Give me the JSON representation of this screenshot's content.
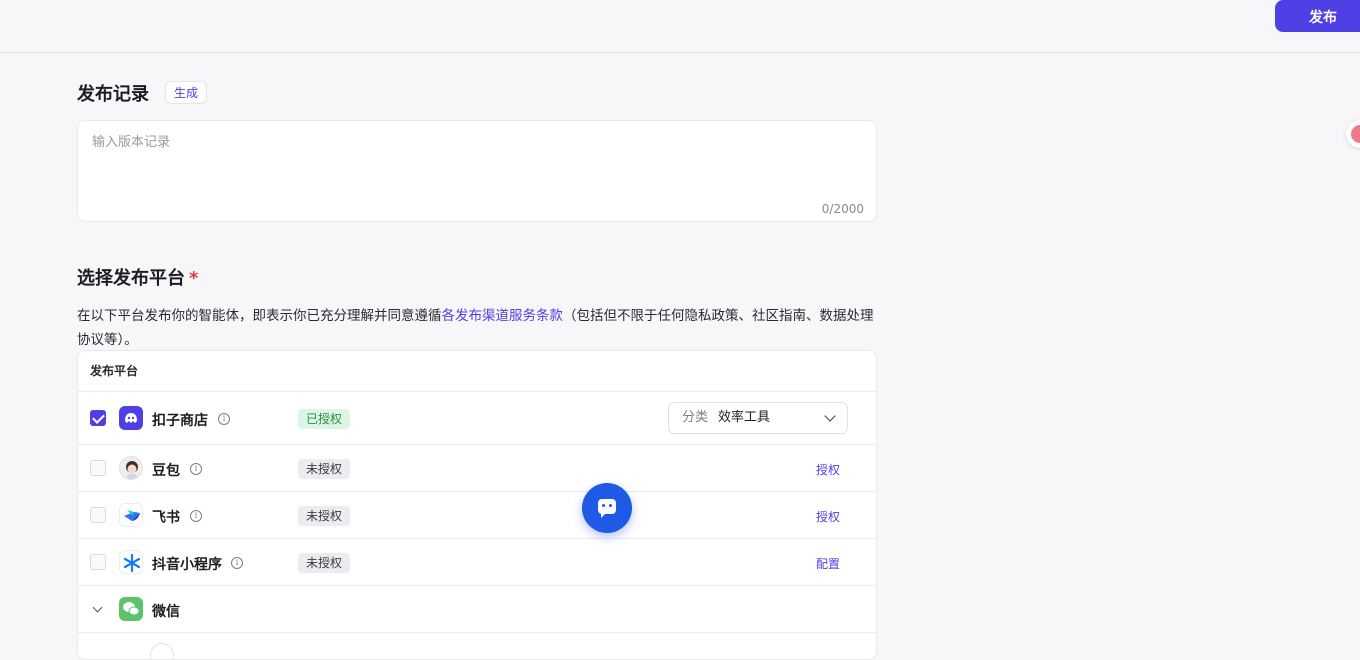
{
  "topbar": {
    "publish_label": "发布"
  },
  "record": {
    "title": "发布记录",
    "generate_label": "生成",
    "placeholder": "输入版本记录",
    "value": "",
    "counter": "0/2000"
  },
  "platform_section": {
    "title": "选择发布平台",
    "required_mark": "*",
    "desc_before": "在以下平台发布你的智能体，即表示你已充分理解并同意遵循",
    "desc_link": "各发布渠道服务条款",
    "desc_after": "（包括但不限于任何隐私政策、社区指南、数据处理协议等）。"
  },
  "table": {
    "header": "发布平台",
    "rows": [
      {
        "name": "扣子商店",
        "status": "已授权",
        "checked": true,
        "category_label": "分类",
        "category_value": "效率工具"
      },
      {
        "name": "豆包",
        "status": "未授权",
        "checked": false,
        "action": "授权"
      },
      {
        "name": "飞书",
        "status": "未授权",
        "checked": false,
        "action": "授权"
      },
      {
        "name": "抖音小程序",
        "status": "未授权",
        "checked": false,
        "action": "配置"
      },
      {
        "name": "微信"
      }
    ]
  },
  "colors": {
    "accent": "#4e40e5",
    "fab": "#1f5ae6",
    "authorized_bg": "#ddf5e4",
    "authorized_text": "#2c8c46"
  },
  "icons": {
    "info": "info-icon",
    "store": "coze-store-icon",
    "doubao": "doubao-avatar-icon",
    "feishu": "feishu-icon",
    "douyin": "douyin-miniapp-icon",
    "wechat": "wechat-icon",
    "assistant": "chat-assistant-icon"
  }
}
